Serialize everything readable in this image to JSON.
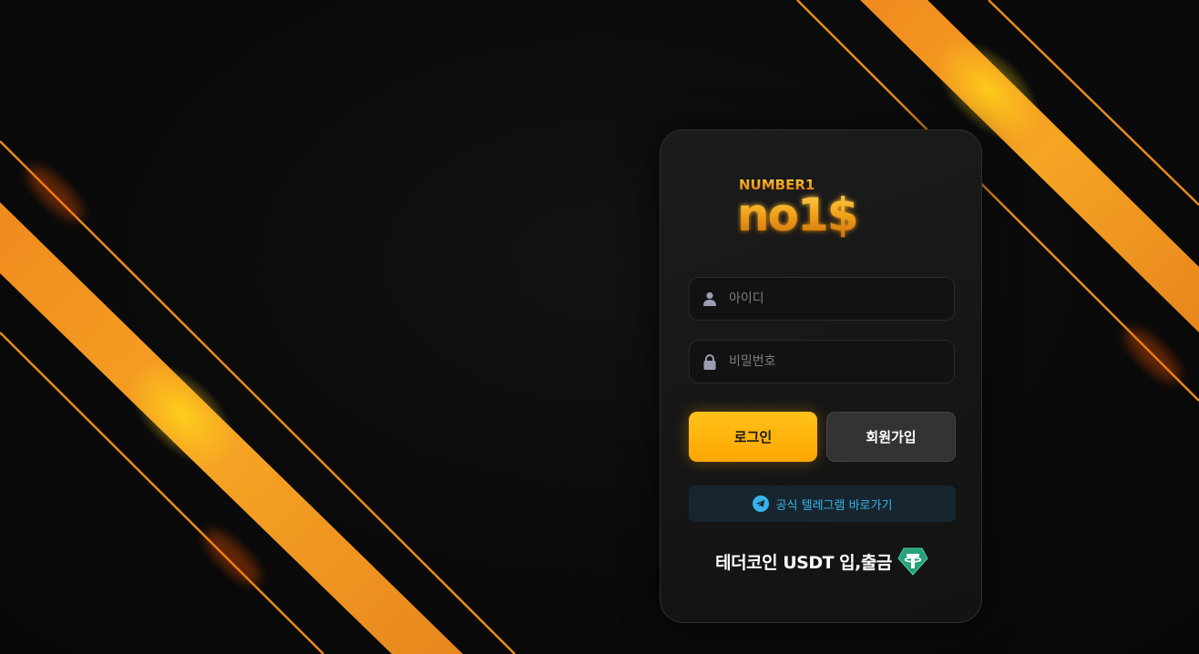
{
  "brand": {
    "logo_top_text": "NUMBER1",
    "logo_main_text": "no1$"
  },
  "login_form": {
    "username_placeholder": "아이디",
    "password_placeholder": "비밀번호",
    "login_label": "로그인",
    "signup_label": "회원가입",
    "telegram_label": "공식 텔레그램 바로가기",
    "usdt_label": "테더코인 USDT 입,출금"
  },
  "icons": {
    "username": "user-icon",
    "password": "lock-icon",
    "telegram": "telegram-icon",
    "tether": "tether-icon"
  },
  "colors": {
    "accent": "#ffb000",
    "stripe": "#f0901a",
    "telegram": "#38b2ea",
    "tether": "#26a17b",
    "card_bg": "#171717",
    "page_bg": "#0b0b0b"
  }
}
